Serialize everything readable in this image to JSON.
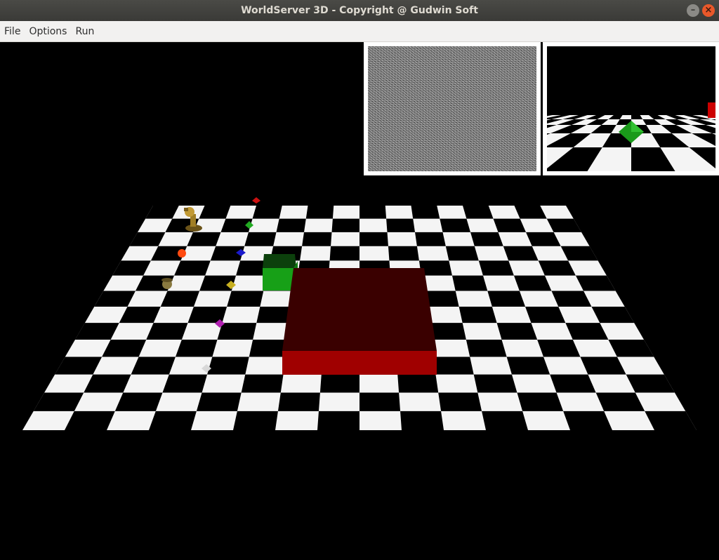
{
  "window": {
    "title": "WorldServer 3D - Copyright @ Gudwin Soft",
    "minimize_glyph": "–",
    "close_glyph": "×"
  },
  "menu": {
    "items": [
      {
        "label": "File"
      },
      {
        "label": "Options"
      },
      {
        "label": "Run"
      }
    ]
  },
  "scene": {
    "floor": "checkerboard",
    "objects": [
      {
        "name": "robot-creature",
        "color": "#b08a2a"
      },
      {
        "name": "green-cube",
        "color": "#1a9a1a"
      },
      {
        "name": "red-brick",
        "color": "#a00000"
      },
      {
        "name": "jewel-red",
        "color": "#cc1111"
      },
      {
        "name": "jewel-green",
        "color": "#22aa22"
      },
      {
        "name": "jewel-blue",
        "color": "#1a1acc"
      },
      {
        "name": "jewel-yellow",
        "color": "#c8b020"
      },
      {
        "name": "jewel-magenta",
        "color": "#b020b0"
      },
      {
        "name": "jewel-white",
        "color": "#dddddd"
      },
      {
        "name": "food-apple",
        "color": "#ff4400"
      },
      {
        "name": "food-nut",
        "color": "#8a7a40"
      }
    ]
  },
  "cameras": [
    {
      "name": "noise-camera",
      "state": "static"
    },
    {
      "name": "creature-camera",
      "state": "first-person"
    }
  ]
}
